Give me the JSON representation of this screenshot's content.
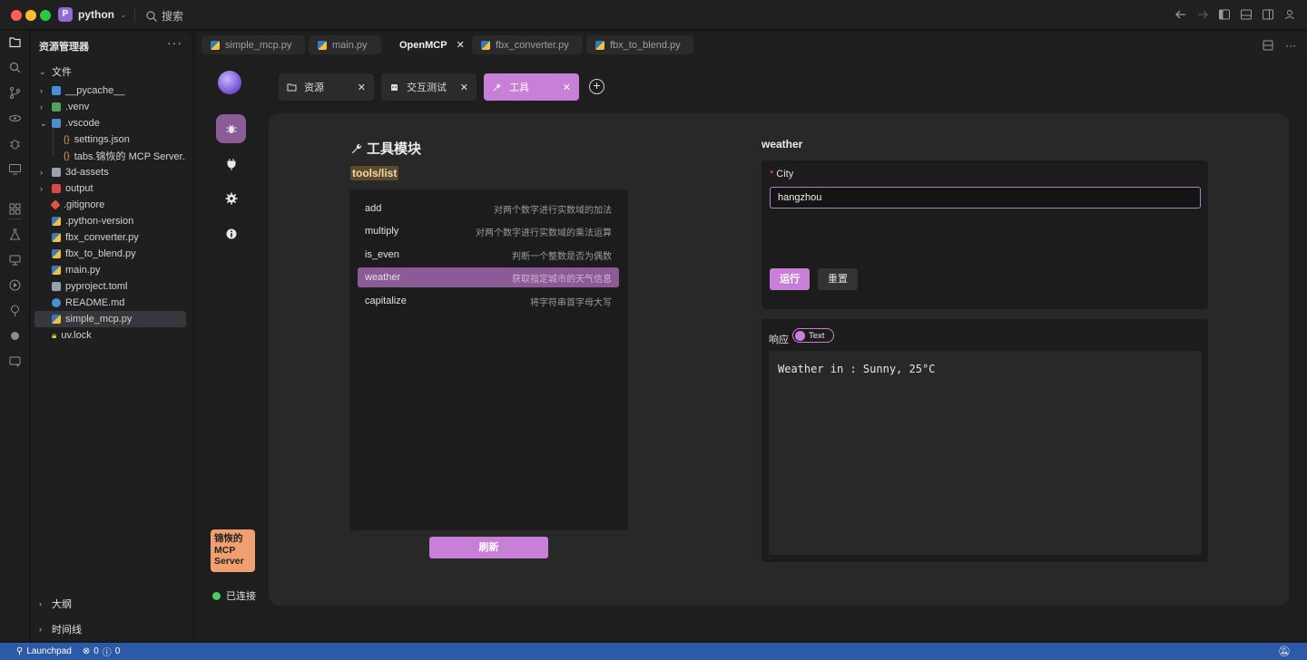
{
  "titlebar": {
    "project_badge": "P",
    "project_name": "python",
    "search_label": "搜索"
  },
  "explorer": {
    "title": "资源管理器",
    "section_files": "文件",
    "items": [
      {
        "name": "__pycache__",
        "kind": "folder",
        "color": "#4a8fd6"
      },
      {
        "name": ".venv",
        "kind": "folder",
        "color": "#4fa35a"
      },
      {
        "name": ".vscode",
        "kind": "folder",
        "color": "#4a8fd6"
      },
      {
        "name": "settings.json",
        "kind": "json",
        "color": "#e0a040"
      },
      {
        "name": "tabs.锦恢的 MCP Server...",
        "kind": "json",
        "color": "#e0a040"
      },
      {
        "name": "3d-assets",
        "kind": "folder",
        "color": "#9aa3ad"
      },
      {
        "name": "output",
        "kind": "folder",
        "color": "#d64a4a"
      },
      {
        "name": ".gitignore",
        "kind": "git",
        "color": "#e0553a"
      },
      {
        "name": ".python-version",
        "kind": "python",
        "color": "#3b78c4"
      },
      {
        "name": "fbx_converter.py",
        "kind": "python",
        "color": "#3b78c4"
      },
      {
        "name": "fbx_to_blend.py",
        "kind": "python",
        "color": "#3b78c4"
      },
      {
        "name": "main.py",
        "kind": "python",
        "color": "#3b78c4"
      },
      {
        "name": "pyproject.toml",
        "kind": "toml",
        "color": "#9aa3ad"
      },
      {
        "name": "README.md",
        "kind": "info",
        "color": "#4a8fd6"
      },
      {
        "name": "simple_mcp.py",
        "kind": "python",
        "color": "#3b78c4"
      },
      {
        "name": "uv.lock",
        "kind": "lock",
        "color": "#e0c040"
      }
    ],
    "section_outline": "大纲",
    "section_timeline": "时间线"
  },
  "editor_tabs": [
    {
      "label": "simple_mcp.py"
    },
    {
      "label": "main.py"
    },
    {
      "label": "OpenMCP"
    },
    {
      "label": "fbx_converter.py"
    },
    {
      "label": "fbx_to_blend.py"
    }
  ],
  "openmcp": {
    "server_name": "锦恢的 MCP Server",
    "status": "已连接",
    "tabs": [
      {
        "label": "资源"
      },
      {
        "label": "交互测试"
      },
      {
        "label": "工具"
      }
    ],
    "module_title": "工具模块",
    "tools_tag": "tools/list",
    "tools": [
      {
        "name": "add",
        "desc": "对两个数字进行实数域的加法"
      },
      {
        "name": "multiply",
        "desc": "对两个数字进行实数域的乘法运算"
      },
      {
        "name": "is_even",
        "desc": "判断一个整数是否为偶数"
      },
      {
        "name": "weather",
        "desc": "获取指定城市的天气信息"
      },
      {
        "name": "capitalize",
        "desc": "将字符串首字母大写"
      }
    ],
    "refresh_label": "刷新",
    "selected_tool": "weather",
    "field_label": "City",
    "field_value": "hangzhou",
    "run_label": "运行",
    "reset_label": "重置",
    "response_label": "响应",
    "response_mode": "Text",
    "response_text": "Weather in : Sunny, 25°C"
  },
  "statusbar": {
    "launchpad": "Launchpad",
    "errors": "0",
    "warnings": "0"
  },
  "colors": {
    "accent": "#c77fd8",
    "selected": "#8c5a96",
    "statusbar": "#2c5aa8",
    "connected": "#3fcf5a",
    "server_badge": "#f0a070"
  }
}
